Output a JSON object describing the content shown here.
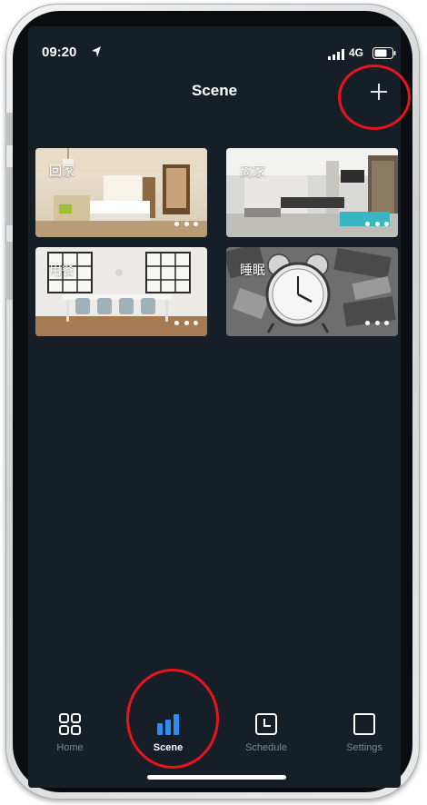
{
  "status_bar": {
    "time": "09:20",
    "network": "4G",
    "icons": [
      "location-arrow-icon",
      "signal-bars-icon",
      "battery-icon"
    ]
  },
  "nav": {
    "title": "Scene",
    "add_icon": "plus-icon"
  },
  "scenes": [
    {
      "name": "回家",
      "more_icon": "more-dots-icon"
    },
    {
      "name": "离家",
      "more_icon": "more-dots-icon"
    },
    {
      "name": "用餐",
      "more_icon": "more-dots-icon"
    },
    {
      "name": "睡眠",
      "more_icon": "more-dots-icon"
    }
  ],
  "tabs": [
    {
      "label": "Home",
      "icon": "grid-icon",
      "active": false
    },
    {
      "label": "Scene",
      "icon": "bar-chart-icon",
      "active": true
    },
    {
      "label": "Schedule",
      "icon": "clock-icon",
      "active": false
    },
    {
      "label": "Settings",
      "icon": "square-icon",
      "active": false
    }
  ],
  "colors": {
    "background": "#161e28",
    "active_tab": "#2d8cf0",
    "inactive_tab": "#7d8591",
    "highlight_circle": "#e8141b"
  }
}
